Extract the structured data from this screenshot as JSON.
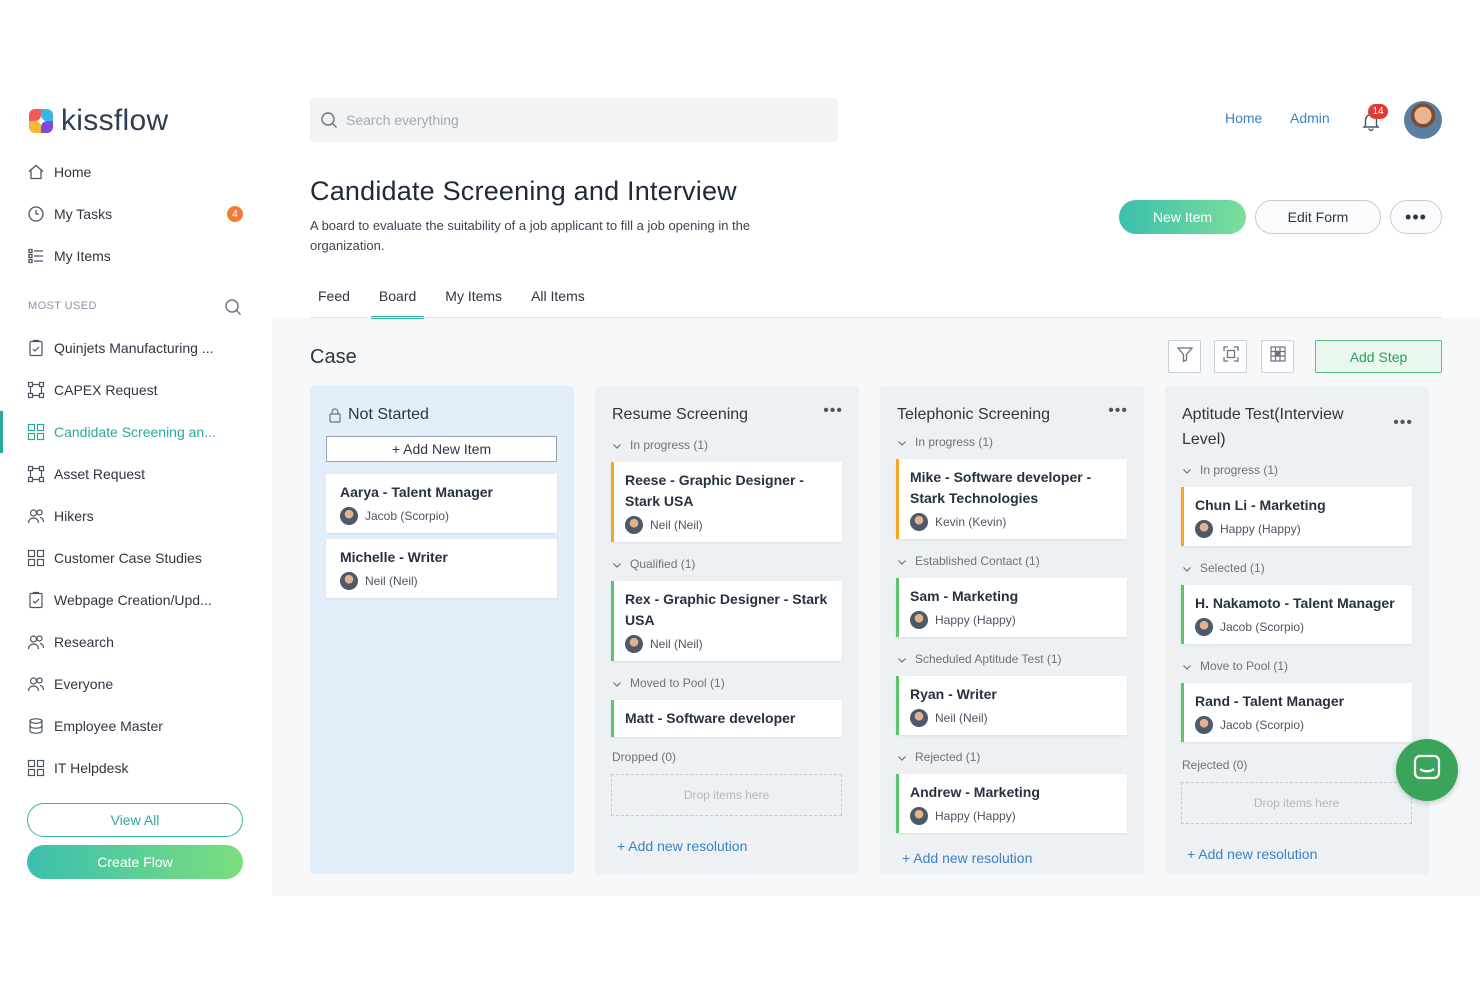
{
  "brand": {
    "name": "kissflow"
  },
  "sidebar": {
    "nav": [
      {
        "label": "Home",
        "icon": "home-icon"
      },
      {
        "label": "My Tasks",
        "icon": "clock-icon",
        "badge": "4"
      },
      {
        "label": "My Items",
        "icon": "list-icon"
      }
    ],
    "section_label": "MOST USED",
    "items": [
      {
        "label": "Quinjets Manufacturing ...",
        "icon": "form-icon"
      },
      {
        "label": "CAPEX Request",
        "icon": "flow-icon"
      },
      {
        "label": "Candidate Screening an...",
        "icon": "board-icon"
      },
      {
        "label": "Asset Request",
        "icon": "flow-icon"
      },
      {
        "label": "Hikers",
        "icon": "people-icon"
      },
      {
        "label": "Customer Case Studies",
        "icon": "board-icon"
      },
      {
        "label": "Webpage Creation/Upd...",
        "icon": "form-icon"
      },
      {
        "label": "Research",
        "icon": "people-icon"
      },
      {
        "label": "Everyone",
        "icon": "people-icon"
      },
      {
        "label": "Employee Master",
        "icon": "database-icon"
      },
      {
        "label": "IT Helpdesk",
        "icon": "board-icon"
      }
    ],
    "view_all": "View All",
    "create_flow": "Create Flow"
  },
  "topbar": {
    "search_placeholder": "Search everything",
    "home": "Home",
    "admin": "Admin",
    "notifications": "14"
  },
  "page": {
    "title": "Candidate Screening and Interview",
    "description": "A board to evaluate the suitability of a job applicant to fill a job opening in the organization.",
    "new_item": "New Item",
    "edit_form": "Edit Form",
    "more": "•••",
    "tabs": [
      "Feed",
      "Board",
      "My Items",
      "All Items"
    ],
    "active_tab": "Board"
  },
  "board": {
    "title": "Case",
    "add_step": "Add Step",
    "columns": [
      {
        "title": "Not Started",
        "add_new_item": "+ Add New Item",
        "cards": [
          {
            "title": "Aarya - Talent Manager",
            "user": "Jacob (Scorpio)"
          },
          {
            "title": "Michelle - Writer",
            "user": "Neil (Neil)"
          }
        ]
      },
      {
        "title": "Resume Screening",
        "groups": [
          {
            "label": "In progress  (1)",
            "cards": [
              {
                "title": "Reese - Graphic Designer - Stark USA",
                "user": "Neil (Neil)"
              }
            ]
          },
          {
            "label": "Qualified  (1)",
            "cards": [
              {
                "title": "Rex - Graphic Designer - Stark USA",
                "user": "Neil (Neil)"
              }
            ]
          },
          {
            "label": "Moved to Pool  (1)",
            "cards": [
              {
                "title": "Matt - Software developer"
              }
            ]
          }
        ],
        "dropped": "Dropped  (0)",
        "drop_hint": "Drop items here",
        "add_resolution": "+ Add new resolution"
      },
      {
        "title": "Telephonic Screening",
        "groups": [
          {
            "label": "In progress  (1)",
            "cards": [
              {
                "title": "Mike - Software developer - Stark Technologies",
                "user": "Kevin (Kevin)"
              }
            ]
          },
          {
            "label": "Established Contact  (1)",
            "cards": [
              {
                "title": "Sam - Marketing",
                "user": "Happy (Happy)"
              }
            ]
          },
          {
            "label": "Scheduled Aptitude Test  (1)",
            "cards": [
              {
                "title": "Ryan - Writer",
                "user": "Neil (Neil)"
              }
            ]
          },
          {
            "label": "Rejected  (1)",
            "cards": [
              {
                "title": "Andrew - Marketing",
                "user": "Happy (Happy)"
              }
            ]
          }
        ],
        "add_resolution": "+ Add new resolution"
      },
      {
        "title": "Aptitude Test(Interview Level)",
        "groups": [
          {
            "label": "In progress  (1)",
            "cards": [
              {
                "title": "Chun Li - Marketing",
                "user": "Happy (Happy)"
              }
            ]
          },
          {
            "label": "Selected  (1)",
            "cards": [
              {
                "title": "H. Nakamoto - Talent Manager",
                "user": "Jacob (Scorpio)"
              }
            ]
          },
          {
            "label": "Move to Pool  (1)",
            "cards": [
              {
                "title": "Rand - Talent Manager",
                "user": "Jacob (Scorpio)"
              }
            ]
          }
        ],
        "rejected": "Rejected  (0)",
        "drop_hint": "Drop items here",
        "add_resolution": "+ Add new resolution"
      }
    ]
  },
  "colors": {
    "accent": "#2aa8a0",
    "link": "#3b82c4",
    "card_orange": "#f5a623",
    "card_green": "#5cc56e",
    "badge": "#f27b3a"
  }
}
